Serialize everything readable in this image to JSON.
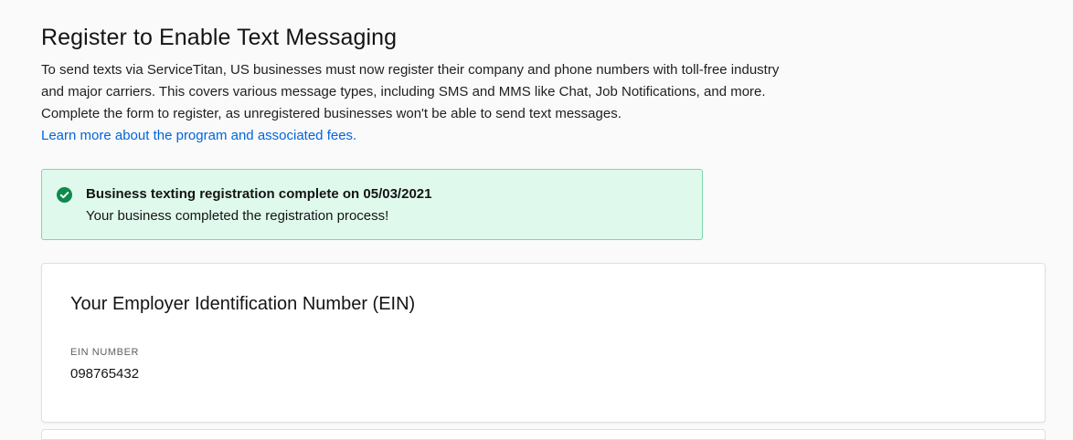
{
  "header": {
    "title": "Register to Enable Text Messaging",
    "intro_text": "To send texts via ServiceTitan, US businesses must now register their company and phone numbers with toll-free industry and major carriers. This covers various message types, including SMS and MMS like Chat, Job Notifications, and more. Complete the form to register, as unregistered businesses won't be able to send text messages.",
    "learn_more_link": "Learn more about the program and associated fees."
  },
  "banner": {
    "status": "success",
    "icon": "check-circle-icon",
    "title": "Business texting registration complete on 05/03/2021",
    "message": "Your business completed the registration process!",
    "colors": {
      "background": "#dffaed",
      "border": "#7ed6aa",
      "icon": "#0f8a4f"
    }
  },
  "ein_card": {
    "title": "Your Employer Identification Number (EIN)",
    "field_label": "EIN NUMBER",
    "field_value": "098765432"
  },
  "colors": {
    "link": "#0265dc",
    "page_background": "#fafafa"
  }
}
